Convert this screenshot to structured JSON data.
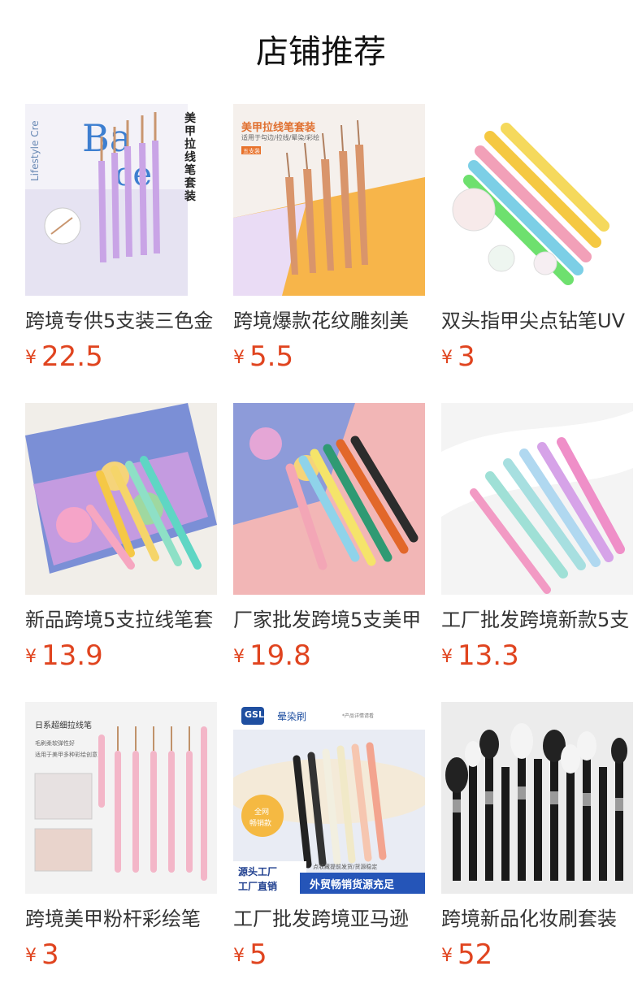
{
  "header": {
    "title": "店铺推荐"
  },
  "products": [
    {
      "name": "跨境专供5支装三色金",
      "price": "22.5",
      "image_text": {
        "brand_lines": [
          "Lifestyle Cre",
          "Ba",
          "ce"
        ],
        "vertical_title": "美甲拉线笔套装"
      }
    },
    {
      "name": "跨境爆款花纹雕刻美",
      "price": "5.5",
      "image_text": {
        "title": "美甲拉线笔套装",
        "subtitle": "适用于勾边/拉线/晕染/彩绘",
        "badge": "五支装"
      }
    },
    {
      "name": "双头指甲尖点钻笔UV",
      "price": "3"
    },
    {
      "name": "新品跨境5支拉线笔套",
      "price": "13.9"
    },
    {
      "name": "厂家批发跨境5支美甲",
      "price": "19.8"
    },
    {
      "name": "工厂批发跨境新款5支",
      "price": "13.3"
    },
    {
      "name": "跨境美甲粉杆彩绘笔",
      "price": "3",
      "image_text": {
        "title": "日系超细拉线笔",
        "line1": "毛刷柔软弹性好",
        "line2": "适用于美甲多种彩绘创意"
      }
    },
    {
      "name": "工厂批发跨境亚马逊",
      "price": "5",
      "image_text": {
        "logo": "GSL",
        "title": "晕染刷",
        "top_note": "*产品详情请看",
        "badge_line1": "全网",
        "badge_line2": "畅销款",
        "left_line1": "源头工厂",
        "left_line2": "工厂直销",
        "strip_note": "点收藏提前发货/货源稳定",
        "strip_main": "外贸畅销货源充足"
      }
    },
    {
      "name": "跨境新品化妆刷套装",
      "price": "52"
    }
  ],
  "currency_symbol": "¥",
  "colors": {
    "price": "#e0441f",
    "title": "#111111"
  }
}
